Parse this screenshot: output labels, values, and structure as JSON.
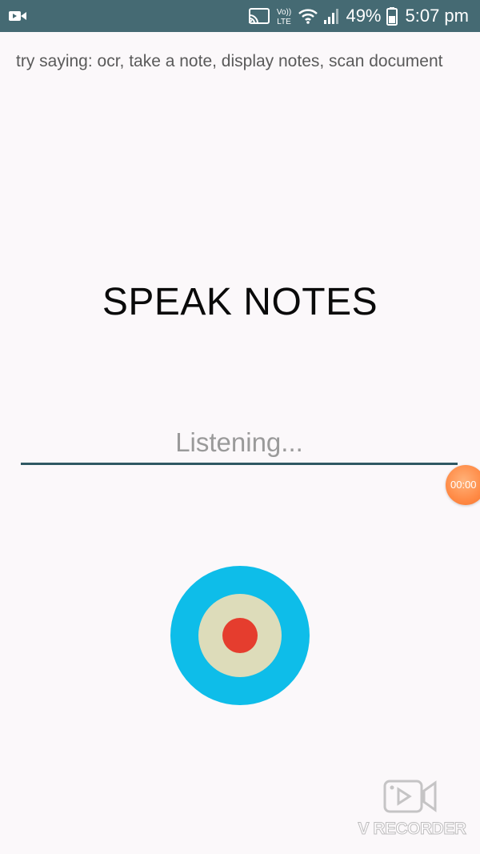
{
  "status_bar": {
    "network_label": "Vo)) LTE",
    "battery_percent": "49%",
    "time": "5:07 pm"
  },
  "hint": {
    "text": "try saying:  ocr, take a note, display notes, scan document"
  },
  "title": "SPEAK NOTES",
  "listen_field": {
    "placeholder": "Listening..."
  },
  "recorder": {
    "timer": "00:00",
    "watermark": "V RECORDER"
  },
  "colors": {
    "status_bar": "#456a73",
    "background": "#fbf8fa",
    "mic_outer": "#0ebde9",
    "mic_inner": "#dddcba",
    "mic_dot": "#e53d2e",
    "underline": "#2f5963"
  }
}
